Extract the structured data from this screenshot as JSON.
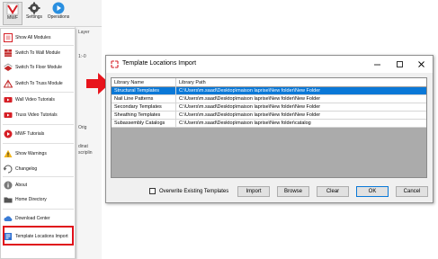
{
  "ribbon": {
    "mwf_label": "MWF",
    "settings_label": "Settings",
    "operations_label": "Operations"
  },
  "background": {
    "fragment_1": "Layer",
    "fragment_2": "1:-0",
    "fragment_3": "Orig",
    "fragment_4": "dinat",
    "fragment_5": "scriplin"
  },
  "module_menu": {
    "items": [
      {
        "label": "Show All Modules",
        "icon": "all-modules-icon"
      },
      {
        "label": "Switch To Wall Module",
        "icon": "wall-module-icon"
      },
      {
        "label": "Switch To Floor Module",
        "icon": "floor-module-icon"
      },
      {
        "label": "Switch To Truss Module",
        "icon": "truss-module-icon"
      },
      {
        "label": "Wall Video Tutorials",
        "icon": "video-icon"
      },
      {
        "label": "Truss Video Tutorials",
        "icon": "video-icon"
      },
      {
        "label": "MWF Tutorials",
        "icon": "tutorials-icon"
      },
      {
        "label": "Show Warnings",
        "icon": "warning-icon"
      },
      {
        "label": "Changelog",
        "icon": "changelog-icon"
      },
      {
        "label": "About",
        "icon": "info-icon"
      },
      {
        "label": "Home Directory",
        "icon": "folder-icon"
      },
      {
        "label": "Download Center",
        "icon": "cloud-icon"
      },
      {
        "label": "Template Locations Import",
        "icon": "template-import-icon"
      }
    ]
  },
  "dialog": {
    "title": "Template Locations Import",
    "columns": [
      "Library Name",
      "Library Path"
    ],
    "rows": [
      {
        "name": "Structural Templates",
        "path": "C:\\Users\\m.saad\\Desktop\\maison laprise\\New folder\\New Folder",
        "selected": true
      },
      {
        "name": "Nail Line Patterns",
        "path": "C:\\Users\\m.saad\\Desktop\\maison laprise\\New folder\\New Folder",
        "selected": false
      },
      {
        "name": "Secondary Templates",
        "path": "C:\\Users\\m.saad\\Desktop\\maison laprise\\New folder\\New Folder",
        "selected": false
      },
      {
        "name": "Sheathing Templates",
        "path": "C:\\Users\\m.saad\\Desktop\\maison laprise\\New folder\\New Folder",
        "selected": false
      },
      {
        "name": "Subassembly Catalogs",
        "path": "C:\\Users\\m.saad\\Desktop\\maison laprise\\New folder\\catalog",
        "selected": false
      }
    ],
    "checkbox_label": "Overwrite Existing Templates",
    "checkbox_checked": false,
    "buttons": {
      "import": "Import",
      "browse": "Browse",
      "clear": "Clear",
      "ok": "OK",
      "cancel": "Cancel"
    }
  },
  "colors": {
    "selection": "#0a78d7",
    "highlight_red": "#e0101a",
    "arrow_red": "#e8141c"
  }
}
